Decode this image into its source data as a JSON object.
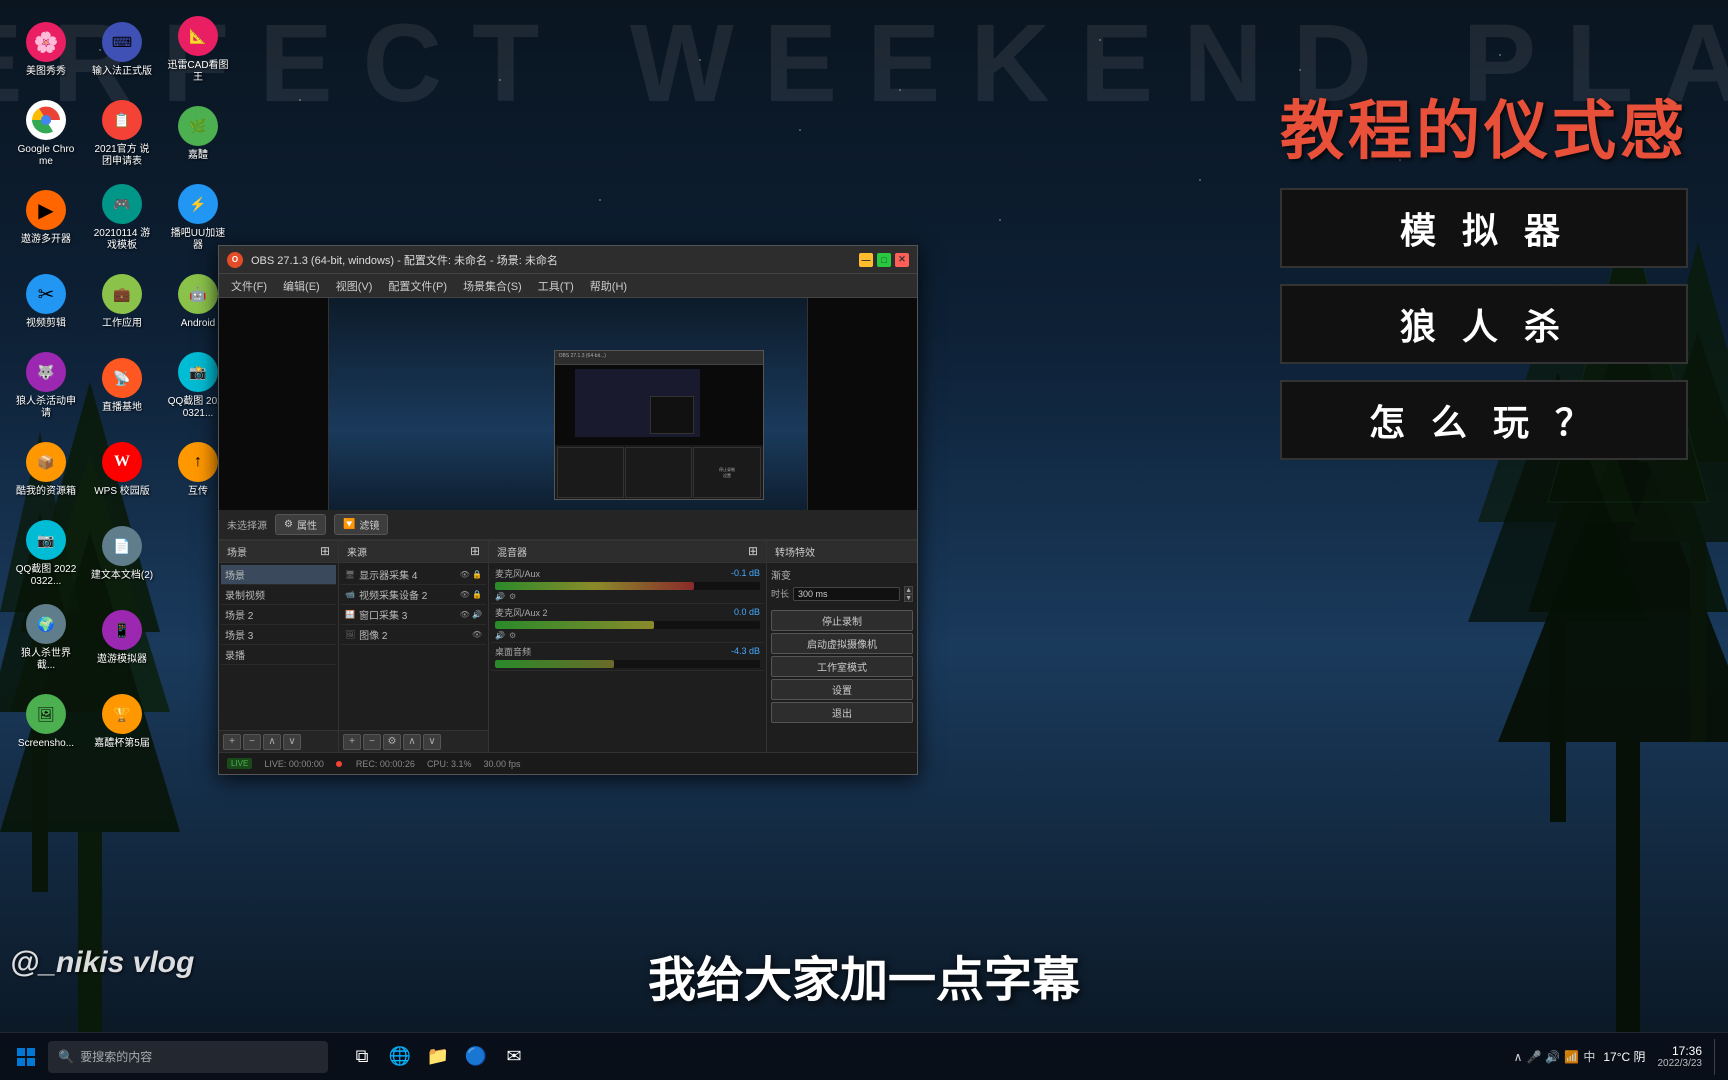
{
  "desktop": {
    "bg_text": "PERFECT WEEKEND PLAN",
    "icons": [
      {
        "id": "meitu",
        "label": "美图秀秀",
        "color": "#e91e63",
        "symbol": "🌸"
      },
      {
        "id": "chrome",
        "label": "Google Chrome",
        "color": "#4285F4",
        "symbol": "🌐"
      },
      {
        "id": "youku",
        "label": "遨游多开器",
        "color": "#FF6600",
        "symbol": "▶"
      },
      {
        "id": "video-edit",
        "label": "视频剪辑",
        "color": "#2196F3",
        "symbol": "✂"
      },
      {
        "id": "werewolf-apply",
        "label": "狼人杀活动申请",
        "color": "#9C27B0",
        "symbol": "🐺"
      },
      {
        "id": "taihe",
        "label": "酷我的资源箱",
        "color": "#FF9800",
        "symbol": "📦"
      },
      {
        "id": "qq-screenshot",
        "label": "QQ截图 20220322...",
        "color": "#00BCD4",
        "symbol": "📷"
      },
      {
        "id": "werewolf-world",
        "label": "狼人杀世界截...",
        "color": "#607D8B",
        "symbol": "🌍"
      },
      {
        "id": "screenshots",
        "label": "Screenshots...",
        "color": "#4CAF50",
        "symbol": "🖼"
      },
      {
        "id": "typing",
        "label": "输入法正式版",
        "color": "#3F51B5",
        "symbol": "⌨"
      },
      {
        "id": "forum-2021",
        "label": "2021官方 说团申请表",
        "color": "#F44336",
        "symbol": "📋"
      },
      {
        "id": "game-template",
        "label": "20210114 游戏模板",
        "color": "#009688",
        "symbol": "🎮"
      },
      {
        "id": "work-app",
        "label": "工作应用",
        "color": "#8BC34A",
        "symbol": "💼"
      },
      {
        "id": "live-base",
        "label": "直播基地",
        "color": "#FF5722",
        "symbol": "📡"
      },
      {
        "id": "wps",
        "label": "WPS 校园版",
        "color": "#FF0000",
        "symbol": "W"
      },
      {
        "id": "new-doc",
        "label": "建文本文档(2)",
        "color": "#607D8B",
        "symbol": "📄"
      },
      {
        "id": "remote-sim",
        "label": "遨游模拟器",
        "color": "#9C27B0",
        "symbol": "📱"
      },
      {
        "id": "cup5",
        "label": "嘉醴杯第5届",
        "color": "#FF9800",
        "symbol": "🏆"
      },
      {
        "id": "autocad",
        "label": "迅雷CAD看图王",
        "color": "#E91E63",
        "symbol": "📐"
      },
      {
        "id": "jiaoli",
        "label": "嘉醴",
        "color": "#4CAF50",
        "symbol": "🌿"
      },
      {
        "id": "uu-addon",
        "label": "播吧UU加速器",
        "color": "#2196F3",
        "symbol": "⚡"
      },
      {
        "id": "android",
        "label": "Android",
        "color": "#8BC34A",
        "symbol": "🤖"
      },
      {
        "id": "qqtube",
        "label": "QQ截图 20220321...",
        "color": "#00BCD4",
        "symbol": "📸"
      },
      {
        "id": "upload",
        "label": "互传",
        "color": "#FF9800",
        "symbol": "↑"
      }
    ]
  },
  "obs_window": {
    "title": "OBS 27.1.3 (64-bit, windows) - 配置文件: 未命名 - 场景: 未命名",
    "menu_items": [
      "文件(F)",
      "编辑(E)",
      "视图(V)",
      "配置文件(P)",
      "场景集合(S)",
      "工具(T)",
      "帮助(H)"
    ],
    "source_bar": {
      "label": "未选择源",
      "btn_properties": "属性",
      "btn_filters": "滤镜"
    },
    "panels": {
      "scenes": {
        "header": "场景",
        "items": [
          "场景",
          "录制视频",
          "场景 2",
          "场景 3",
          "录播"
        ]
      },
      "sources": {
        "header": "来源",
        "items": [
          "显示器采集 4",
          "视频采集设备 2",
          "窗口采集 3",
          "图像 2"
        ]
      },
      "mixer": {
        "header": "混音器",
        "channels": [
          {
            "name": "麦克风/Aux",
            "level": "-0.1 dB",
            "fill_width": "75%"
          },
          {
            "name": "麦克风/Aux 2",
            "level": "0.0 dB",
            "fill_width": "60%"
          },
          {
            "name": "桌面音频",
            "level": "-4.3 dB",
            "fill_width": "45%"
          }
        ]
      },
      "transitions": {
        "header": "转场特效",
        "type": "渐变",
        "duration_label": "时长",
        "duration_value": "300 ms",
        "buttons": [
          "停止录制",
          "启动虚拟摄像机",
          "工作室模式",
          "设置",
          "退出"
        ]
      }
    },
    "statusbar": {
      "live": "LIVE: 00:00:00",
      "rec": "REC: 00:00:26",
      "cpu": "CPU: 3.1%",
      "fps": "30.00 fps"
    }
  },
  "overlay_texts": {
    "title": "教程的仪式感",
    "features": [
      "模 拟 器",
      "狼 人 杀",
      "怎 么 玩 ？"
    ],
    "watermark": "@_nikis vlog",
    "subtitle": "我给大家加一点字幕"
  },
  "taskbar": {
    "search_placeholder": "要搜索的内容",
    "weather": "17°C 阴",
    "time": "17:36",
    "date": "2022/3/23",
    "language": "中"
  }
}
